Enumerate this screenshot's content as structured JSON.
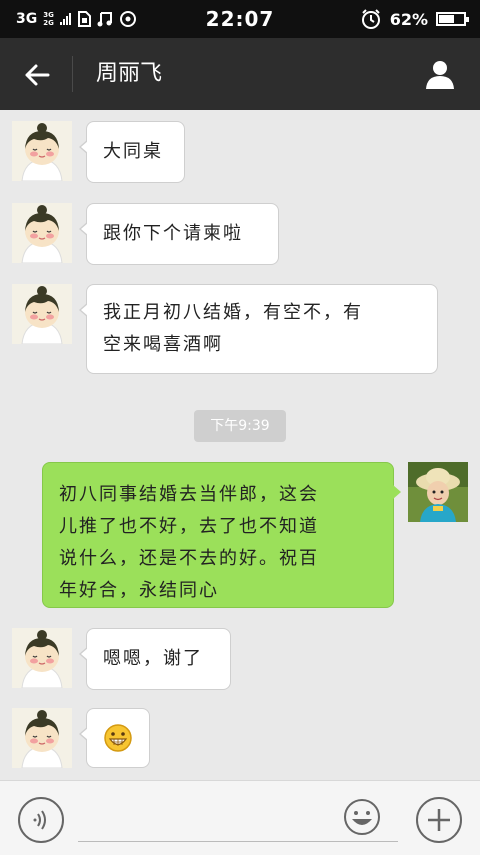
{
  "status_bar": {
    "network": "3G",
    "network_secondary": [
      "3G",
      "2G"
    ],
    "time": "22:07",
    "battery": "62%",
    "battery_level": 0.62
  },
  "header": {
    "back_icon": "arrow-left-icon",
    "title": "周丽飞",
    "profile_icon": "person-icon"
  },
  "messages": [
    {
      "side": "left",
      "text": "大同桌"
    },
    {
      "side": "left",
      "text": "跟你下个请柬啦"
    },
    {
      "side": "left",
      "lines": [
        "我正月初八结婚，有空不，有",
        "空来喝喜酒啊"
      ]
    },
    {
      "side": "time",
      "text": "下午9:39"
    },
    {
      "side": "right",
      "lines": [
        "初八同事结婚去当伴郎，这会",
        "儿推了也不好，去了也不知道",
        "说什么，还是不去的好。祝百",
        "年好合，永结同心"
      ]
    },
    {
      "side": "left",
      "text": "嗯嗯，谢了"
    },
    {
      "side": "left",
      "emoji": "grinning-face-icon"
    }
  ],
  "input_bar": {
    "voice_icon": "voice-icon",
    "emoji_icon": "emoji-icon",
    "add_icon": "plus-icon"
  },
  "colors": {
    "header_bg": "#2d2d2d",
    "chat_bg": "#e9e9e9",
    "my_bubble": "#9be05a",
    "their_bubble": "#ffffff"
  }
}
